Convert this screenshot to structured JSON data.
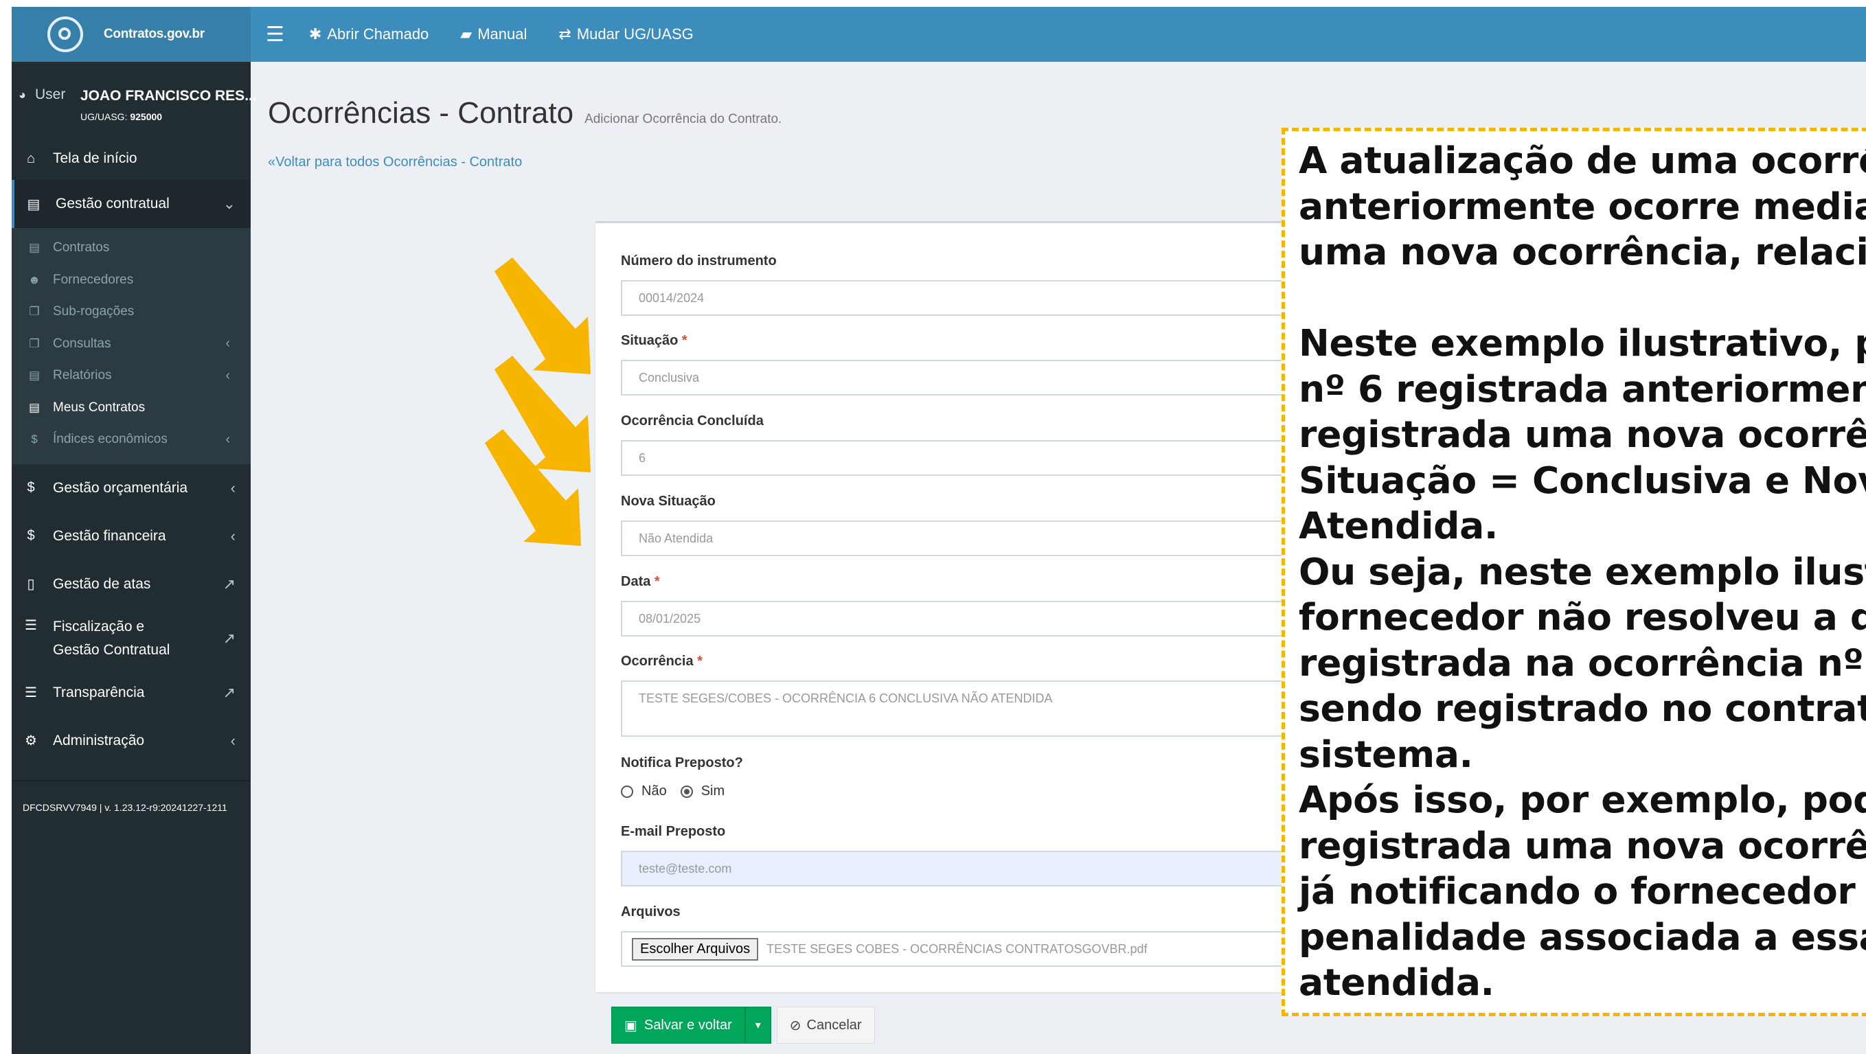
{
  "brand": {
    "name": "Contratos.gov.br"
  },
  "topnav": {
    "menu_icon": "hamburger-icon",
    "items": [
      {
        "icon": "bug-icon",
        "label": "Abrir Chamado"
      },
      {
        "icon": "book-icon",
        "label": "Manual"
      },
      {
        "icon": "exchange-icon",
        "label": "Mudar UG/UASG"
      }
    ]
  },
  "user": {
    "label": "User",
    "name": "JOAO FRANCISCO RES...",
    "ug_label": "UG/UASG:",
    "ug_value": "925000"
  },
  "sidebar": {
    "home": "Tela de início",
    "gestao_contratual": "Gestão contratual",
    "submenu": [
      {
        "label": "Contratos",
        "icon": "file-icon"
      },
      {
        "label": "Fornecedores",
        "icon": "users-icon"
      },
      {
        "label": "Sub-rogações",
        "icon": "copy-icon"
      },
      {
        "label": "Consultas",
        "icon": "copy-icon",
        "has_arrow": true
      },
      {
        "label": "Relatórios",
        "icon": "file-icon",
        "has_arrow": true
      },
      {
        "label": "Meus Contratos",
        "icon": "file-icon"
      },
      {
        "label": "Índices econômicos",
        "icon": "dollar-icon",
        "has_arrow": true
      }
    ],
    "orcamentaria": "Gestão orçamentária",
    "financeira": "Gestão financeira",
    "atas": "Gestão de atas",
    "fiscalizacao_line1": "Fiscalização e",
    "fiscalizacao_line2": "Gestão Contratual",
    "transparencia": "Transparência",
    "administracao": "Administração",
    "version": "DFCDSRVV7949 | v. 1.23.12-r9:20241227-1211"
  },
  "page": {
    "title": "Ocorrências - Contrato",
    "subtitle": "Adicionar Ocorrência do Contrato.",
    "back_link": "Voltar para todos Ocorrências - Contrato"
  },
  "form": {
    "numero_label": "Número do instrumento",
    "numero_value": "00014/2024",
    "situacao_label": "Situação",
    "situacao_value": "Conclusiva",
    "concluida_label": "Ocorrência Concluída",
    "concluida_value": "6",
    "nova_situacao_label": "Nova Situação",
    "nova_situacao_value": "Não Atendida",
    "data_label": "Data",
    "data_value": "08/01/2025",
    "ocorrencia_label": "Ocorrência",
    "ocorrencia_value": "TESTE SEGES/COBES - OCORRÊNCIA 6 CONCLUSIVA NÃO ATENDIDA",
    "notifica_label": "Notifica Preposto?",
    "notifica_options": [
      "Não",
      "Sim"
    ],
    "notifica_selected": "Sim",
    "email_label": "E-mail Preposto",
    "email_value": "teste@teste.com",
    "arquivos_label": "Arquivos",
    "arquivos_button": "Escolher Arquivos",
    "arquivos_value": "TESTE SEGES COBES - OCORRÊNCIAS CONTRATOSGOVBR.pdf",
    "required_mark": "*"
  },
  "actions": {
    "save": "Salvar e voltar",
    "cancel": "Cancelar"
  },
  "annotation": {
    "text": "A atualização de uma ocorrênc\nanteriormente ocorre mediant\numa nova ocorrência, relacion\n\nNeste exemplo ilustrativo, par\nnº 6 registrada anteriormente,\nregistrada uma nova ocorrênci\nSituação = Conclusiva e Nova S\nAtendida.\nOu seja, neste exemplo ilustra\nfornecedor não resolveu a que\nregistrada na ocorrência nº 6 e\nsendo registrado no contrato c\nsistema.\nApós isso, por exemplo, poderi\nregistrada uma nova ocorrênci\njá notificando o fornecedor de\npenalidade associada a essa oc\natendida.",
    "border_color": "#f7b500",
    "arrow_color": "#f7b500"
  },
  "colors": {
    "topbar": "#3c8dbc",
    "sidebar": "#222d32",
    "save_button": "#00a65a",
    "link": "#3c8dbc"
  }
}
